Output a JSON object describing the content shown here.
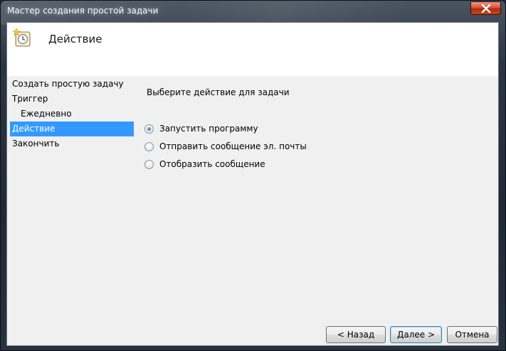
{
  "window": {
    "title": "Мастер создания простой задачи"
  },
  "header": {
    "title": "Действие",
    "icon": "task-clock-icon"
  },
  "nav": {
    "items": [
      {
        "label": "Создать простую задачу"
      },
      {
        "label": "Триггер"
      },
      {
        "label": "Ежедневно"
      },
      {
        "label": "Действие"
      },
      {
        "label": "Закончить"
      }
    ],
    "active_index": 3
  },
  "main": {
    "prompt": "Выберите действие для задачи",
    "options": [
      {
        "label": "Запустить программу",
        "selected": true
      },
      {
        "label": "Отправить сообщение эл. почты",
        "selected": false
      },
      {
        "label": "Отобразить сообщение",
        "selected": false
      }
    ]
  },
  "buttons": {
    "back": "< Назад",
    "next": "Далее >",
    "cancel": "Отмена"
  },
  "colors": {
    "selection": "#3399ff",
    "close_button": "#c8471d"
  }
}
